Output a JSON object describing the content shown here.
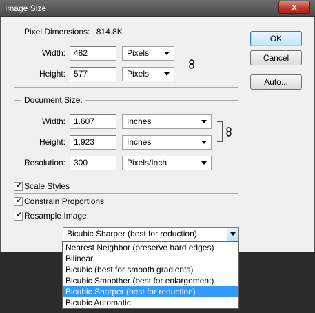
{
  "window": {
    "title": "Image Size",
    "close_glyph": "x"
  },
  "pixel_dimensions": {
    "legend": "Pixel Dimensions:",
    "size": "814.8K",
    "width": {
      "label": "Width:",
      "value": "482",
      "unit": "Pixels"
    },
    "height": {
      "label": "Height:",
      "value": "577",
      "unit": "Pixels"
    }
  },
  "document_size": {
    "legend": "Document Size:",
    "width": {
      "label": "Width:",
      "value": "1.607",
      "unit": "Inches"
    },
    "height": {
      "label": "Height:",
      "value": "1.923",
      "unit": "Inches"
    },
    "resolution": {
      "label": "Resolution:",
      "value": "300",
      "unit": "Pixels/Inch"
    }
  },
  "buttons": {
    "ok": "OK",
    "cancel": "Cancel",
    "auto": "Auto..."
  },
  "options": {
    "scale_styles": {
      "label": "Scale Styles",
      "checked": true
    },
    "constrain_proportions": {
      "label": "Constrain Proportions",
      "checked": true
    },
    "resample_image": {
      "label": "Resample Image:",
      "checked": true
    }
  },
  "resample": {
    "selected": "Bicubic Sharper (best for reduction)",
    "options": [
      "Nearest Neighbor (preserve hard edges)",
      "Bilinear",
      "Bicubic (best for smooth gradients)",
      "Bicubic Smoother (best for enlargement)",
      "Bicubic Sharper (best for reduction)",
      "Bicubic Automatic"
    ]
  },
  "colors": {
    "highlight": "#3399ff",
    "close": "#c0392b"
  }
}
